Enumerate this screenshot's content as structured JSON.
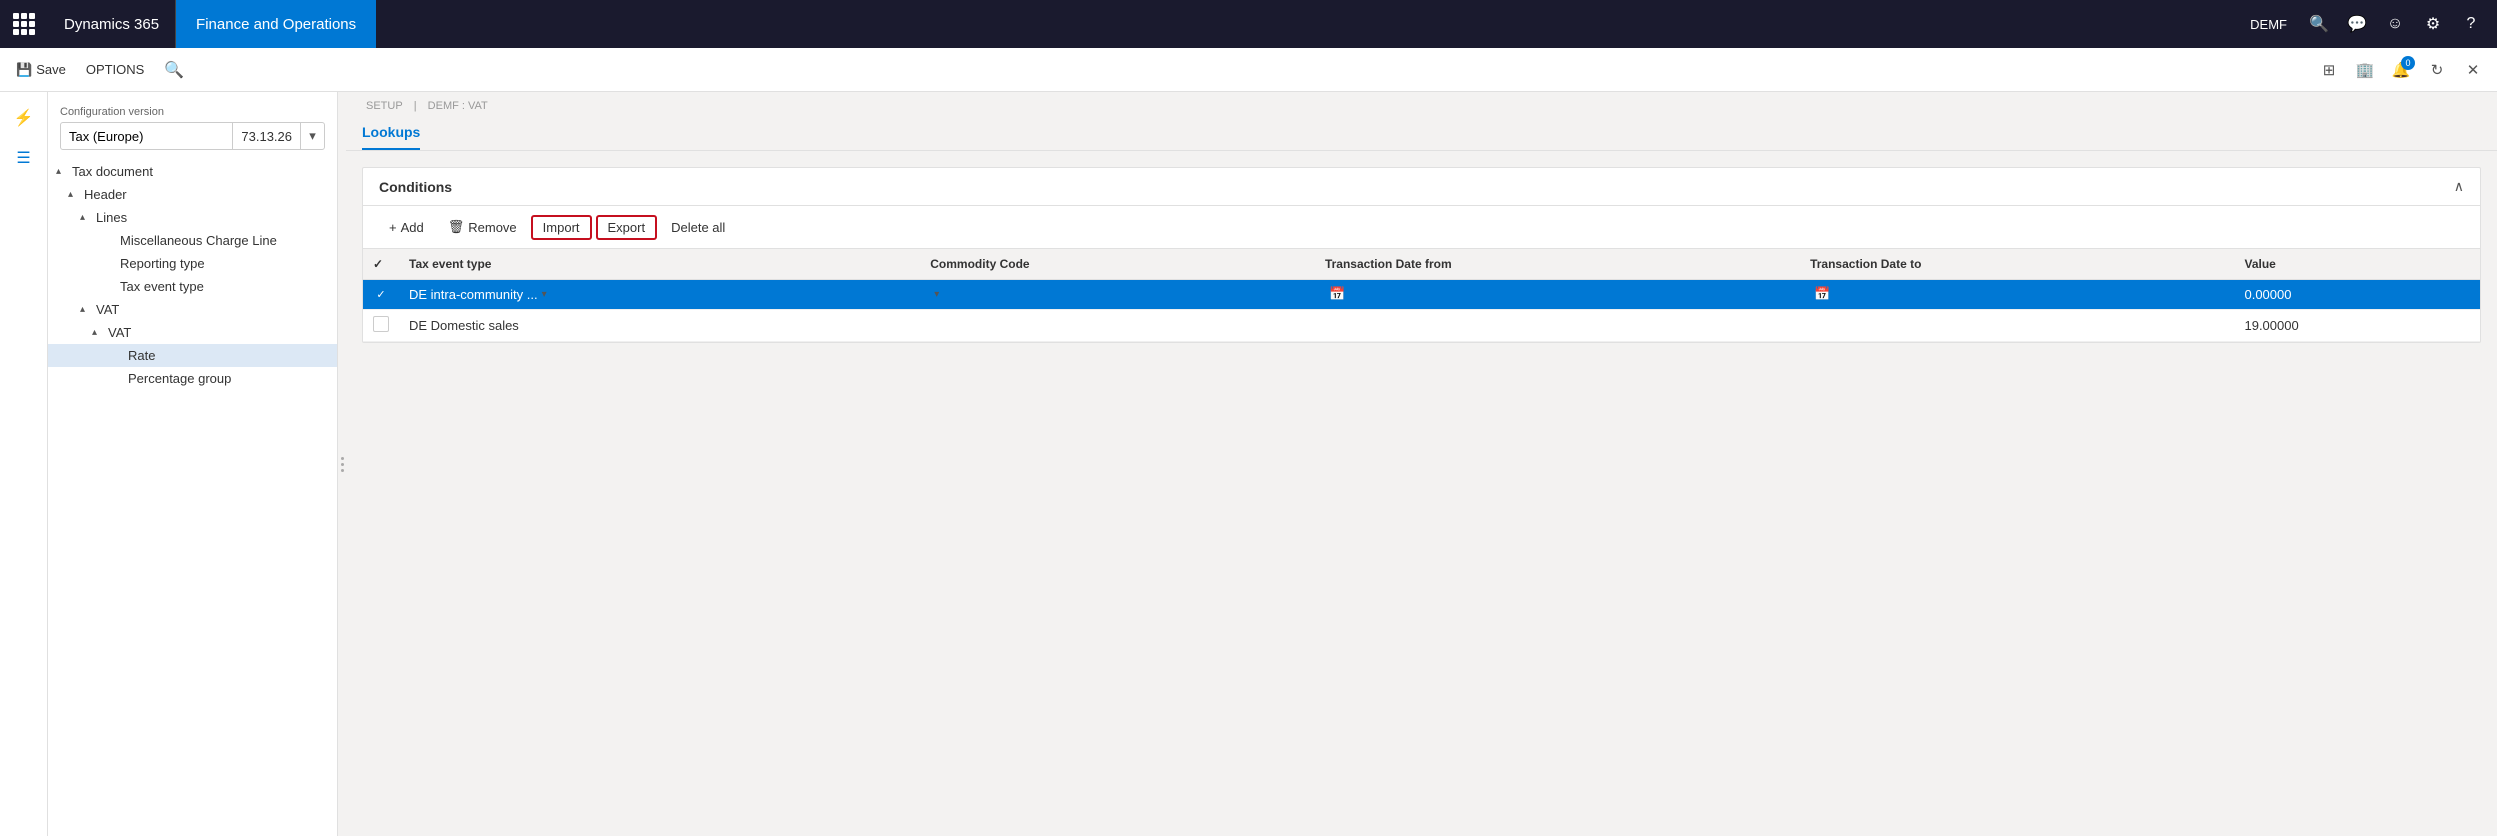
{
  "topbar": {
    "waffle_label": "waffle menu",
    "brand_d365": "Dynamics 365",
    "brand_fo": "Finance and Operations",
    "user_label": "DEMF",
    "icons": {
      "search": "🔍",
      "chat": "💬",
      "user": "😊",
      "settings": "⚙",
      "help": "?"
    },
    "right_icons": {
      "grid": "⊞",
      "office": "🏢",
      "notifications": "🔔",
      "notification_count": "0",
      "refresh": "↻",
      "fullscreen": "⤢"
    }
  },
  "toolbar": {
    "save_label": "Save",
    "options_label": "OPTIONS",
    "search_icon": "🔍",
    "right_icons": {
      "grid_view": "⊞",
      "office_icon": "🏢",
      "notification": "🔔",
      "refresh": "↻",
      "close": "✕"
    }
  },
  "sidebar": {
    "icons": {
      "filter": "⚡",
      "menu": "☰"
    }
  },
  "nav_panel": {
    "config_version_label": "Configuration version",
    "config_name": "Tax (Europe)",
    "config_version": "73.13.26",
    "tree": [
      {
        "id": "tax-document",
        "label": "Tax document",
        "level": 0,
        "expanded": true,
        "has_children": true
      },
      {
        "id": "header",
        "label": "Header",
        "level": 1,
        "expanded": true,
        "has_children": true
      },
      {
        "id": "lines",
        "label": "Lines",
        "level": 2,
        "expanded": true,
        "has_children": true
      },
      {
        "id": "misc-charge-line",
        "label": "Miscellaneous Charge Line",
        "level": 3,
        "expanded": false,
        "has_children": false
      },
      {
        "id": "reporting-type",
        "label": "Reporting type",
        "level": 3,
        "expanded": false,
        "has_children": false
      },
      {
        "id": "tax-event-type",
        "label": "Tax event type",
        "level": 3,
        "expanded": false,
        "has_children": false
      },
      {
        "id": "vat",
        "label": "VAT",
        "level": 2,
        "expanded": true,
        "has_children": true
      },
      {
        "id": "vat-inner",
        "label": "VAT",
        "level": 3,
        "expanded": true,
        "has_children": true
      },
      {
        "id": "rate",
        "label": "Rate",
        "level": 4,
        "expanded": false,
        "has_children": false,
        "active": true
      },
      {
        "id": "percentage-group",
        "label": "Percentage group",
        "level": 4,
        "expanded": false,
        "has_children": false
      }
    ]
  },
  "breadcrumb": {
    "setup": "SETUP",
    "separator": "|",
    "path": "DEMF : VAT"
  },
  "page": {
    "tab_label": "Lookups",
    "conditions_title": "Conditions",
    "action_buttons": {
      "add": "+ Add",
      "remove": "Remove",
      "import": "Import",
      "export": "Export",
      "delete_all": "Delete all"
    },
    "table": {
      "columns": [
        "",
        "Tax event type",
        "Commodity Code",
        "Transaction Date from",
        "Transaction Date to",
        "Value"
      ],
      "rows": [
        {
          "checked": true,
          "tax_event_type": "DE intra-community ...",
          "commodity_code": "",
          "transaction_date_from": "",
          "transaction_date_to": "",
          "value": "0.00000",
          "selected": true
        },
        {
          "checked": false,
          "tax_event_type": "DE Domestic sales",
          "commodity_code": "",
          "transaction_date_from": "",
          "transaction_date_to": "",
          "value": "19.00000",
          "selected": false
        }
      ]
    }
  }
}
